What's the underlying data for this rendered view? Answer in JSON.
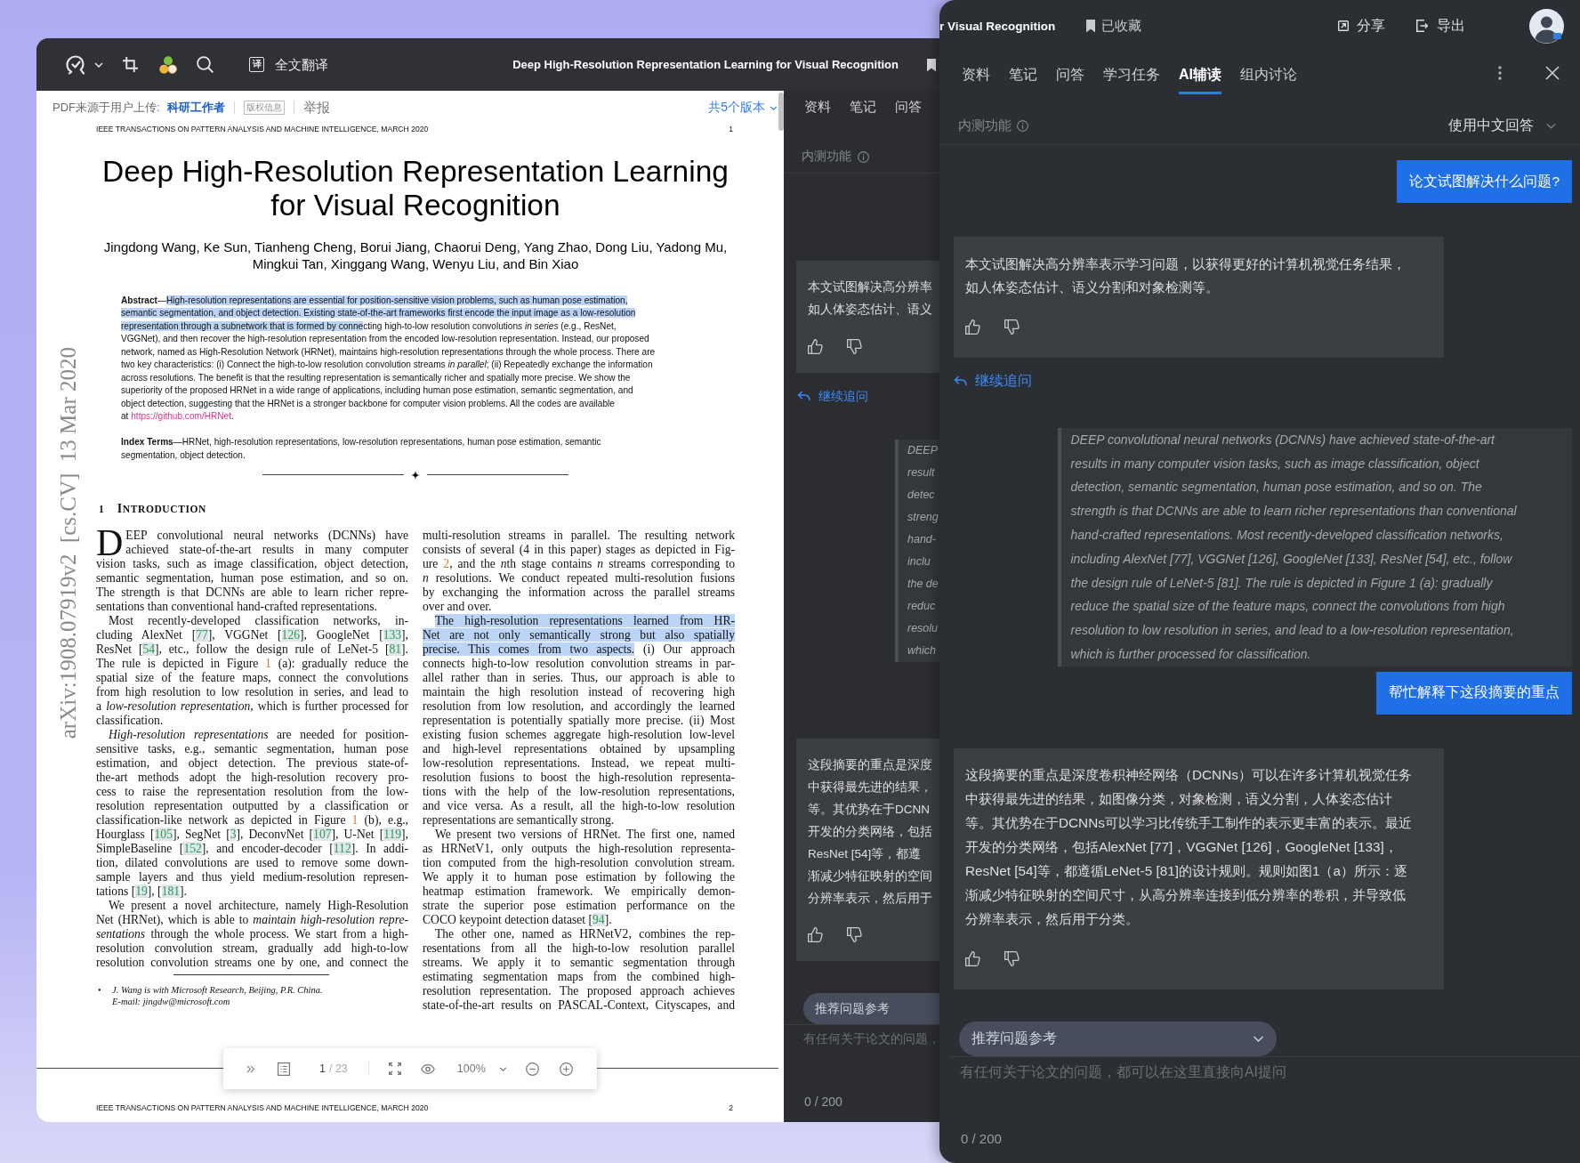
{
  "pdf_window": {
    "toolbar": {
      "translate_glyph": "译",
      "translate_label": "全文翻译",
      "title": "Deep High-Resolution Representation Learning for Visual Recognition",
      "saved": true
    },
    "source_bar": {
      "prefix": "PDF来源于用户上传:",
      "uploader": "科研工作者",
      "copyright_tag": "版权信息",
      "report": "举报",
      "versions": "共5个版本"
    },
    "paper": {
      "running_head": "IEEE TRANSACTIONS ON PATTERN ANALYSIS AND MACHINE INTELLIGENCE, MARCH 2020",
      "page_number": "1",
      "side_stamp": "arXiv:1908.07919v2  [cs.CV]  13 Mar 2020",
      "title_lines": [
        "Deep High-Resolution Representation Learning",
        "for Visual Recognition"
      ],
      "author_lines": [
        "Jingdong Wang, Ke Sun, Tianheng Cheng, Borui Jiang, Chaorui Deng, Yang Zhao, Dong Liu, Yadong Mu,",
        "Mingkui Tan, Xinggang Wang, Wenyu Liu, and Bin Xiao"
      ],
      "abstract": [
        [
          "**Abstract**—",
          {
            "kind": "highlight",
            "text": "High-resolution representations are essential for position-sensitive vision problems, such as human pose estimation,"
          }
        ],
        [
          {
            "kind": "highlight",
            "text": "semantic segmentation, and object detection. Existing state-of-the-art frameworks first encode the input image as a low-resolution"
          }
        ],
        [
          {
            "kind": "highlight",
            "text": "representation through a subnetwork that is formed by conne"
          },
          "cting high-to-low resolution convolutions *in series* (e.g., ResNet,"
        ],
        "VGGNet), and then recover the high-resolution representation from the encoded low-resolution representation. Instead, our proposed",
        "network, named as High-Resolution Network (HRNet), maintains high-resolution representations through the whole process. There are",
        "two key characteristics: (i) Connect the high-to-low resolution convolution streams *in parallel*; (ii) Repeatedly exchange the information",
        "across resolutions. The benefit is that the resulting representation is semantically richer and spatially more precise. We show the",
        "superiority of the proposed HRNet in a wide range of applications, including human pose estimation, semantic segmentation, and",
        "object detection, suggesting that the HRNet is a stronger backbone for computer vision problems. All the codes are available",
        [
          "at ",
          {
            "kind": "link",
            "text": "https://github.com/HRNet"
          },
          "."
        ]
      ],
      "index_terms": [
        "**Index Terms**—HRNet, high-resolution representations, low-resolution representations, human pose estimation, semantic",
        "segmentation, object detection."
      ],
      "section": {
        "number": "1",
        "title": "INTRODUCTION"
      },
      "columns": [
        [
          {
            "kind": "dropcap",
            "drop_cap": "D",
            "continues_next": false,
            "lines": [
              "EEP convolutional neural networks (DCNNs) have",
              "achieved state-of-the-art results in many computer",
              "vision tasks, such as image classification, object detection,",
              "semantic segmentation, human pose estimation, and so on.",
              "The strength is that DCNNs are able to learn richer repre-",
              "sentations than conventional hand-crafted representations."
            ]
          },
          {
            "kind": "indented",
            "lines": [
              "Most recently-developed classification networks, in-",
              [
                "cluding AlexNet [",
                {
                  "kind": "cite",
                  "text": "77"
                },
                "], VGGNet [",
                {
                  "kind": "cite",
                  "text": "126"
                },
                "], GoogleNet [",
                {
                  "kind": "cite",
                  "text": "133"
                },
                "],"
              ],
              [
                "ResNet [",
                {
                  "kind": "cite",
                  "text": "54"
                },
                "], etc., follow the design rule of LeNet-5 [",
                {
                  "kind": "cite",
                  "text": "81"
                },
                "]."
              ],
              [
                "The rule is depicted in Figure ",
                {
                  "kind": "figref",
                  "text": "1"
                },
                " (a): gradually reduce the"
              ],
              "spatial size of the feature maps, connect the convolutions",
              "from high resolution to low resolution in series, and lead to",
              "a *low-resolution representation*, which is further processed for",
              "classification."
            ]
          },
          {
            "kind": "indented",
            "continues_next": false,
            "lines": [
              "*High-resolution representations* are needed for position-",
              "sensitive tasks, e.g., semantic segmentation, human pose",
              "estimation, and object detection. The previous state-of-",
              "the-art methods adopt the high-resolution recovery pro-",
              "cess to raise the representation resolution from the low-",
              "resolution representation outputted by a classification or",
              [
                "classification-like network as depicted in Figure ",
                {
                  "kind": "figref",
                  "text": "1"
                },
                " (b), e.g.,"
              ],
              [
                "Hourglass [",
                {
                  "kind": "cite",
                  "text": "105"
                },
                "], SegNet [",
                {
                  "kind": "cite",
                  "text": "3"
                },
                "], DeconvNet [",
                {
                  "kind": "cite",
                  "text": "107"
                },
                "], U-Net [",
                {
                  "kind": "cite",
                  "text": "119"
                },
                "],"
              ],
              [
                "SimpleBaseline [",
                {
                  "kind": "cite",
                  "text": "152"
                },
                "], and encoder-decoder [",
                {
                  "kind": "cite",
                  "text": "112"
                },
                "]. In addi-"
              ],
              "tion, dilated convolutions are used to remove some down-",
              "sample layers and thus yield medium-resolution represen-",
              [
                "tations [",
                {
                  "kind": "cite",
                  "text": "19"
                },
                "], [",
                {
                  "kind": "cite",
                  "text": "181"
                },
                "]."
              ]
            ]
          },
          {
            "kind": "indented",
            "continues_next": true,
            "lines": [
              "We present a novel architecture, namely High-Resolution",
              "Net (HRNet), which is able to *maintain high-resolution repre-*",
              "*sentations* through the whole process. We start from a high-",
              "resolution convolution stream, gradually add high-to-low",
              "resolution convolution streams one by one, and connect the"
            ]
          }
        ],
        [
          {
            "kind": "continued",
            "continues_next": false,
            "lines": [
              "multi-resolution streams in parallel. The resulting network",
              "consists of several (4 in this paper) stages as depicted in Fig-",
              [
                "ure ",
                {
                  "kind": "figref",
                  "text": "2"
                },
                ", and the *n*",
                "th stage contains *n* streams corresponding to"
              ],
              "*n* resolutions. We conduct repeated multi-resolution fusions",
              "by exchanging the information across the parallel streams",
              "over and over."
            ]
          },
          {
            "kind": "indented",
            "continues_next": false,
            "lines": [
              [
                {
                  "kind": "highlight",
                  "text": "The high-resolution representations learned from HR-"
                }
              ],
              [
                {
                  "kind": "highlight",
                  "text": "Net are not only semantically strong but also spatially"
                }
              ],
              [
                {
                  "kind": "highlight",
                  "text": "precise. This comes from two aspects."
                },
                " (i) Our approach"
              ],
              "connects high-to-low resolution convolution streams in par-",
              "allel rather than in series. Thus, our approach is able to",
              "maintain the high resolution instead of recovering high",
              "resolution from low resolution, and accordingly the learned",
              "representation is potentially spatially more precise. (ii) Most",
              "existing fusion schemes aggregate high-resolution low-level",
              "and high-level representations obtained by upsampling",
              "low-resolution representations. Instead, we repeat multi-",
              "resolution fusions to boost the high-resolution representa-",
              "tions with the help of the low-resolution representations,",
              "and vice versa. As a result, all the high-to-low resolution",
              "representations are semantically strong."
            ]
          },
          {
            "kind": "indented",
            "continues_next": false,
            "lines": [
              "We present two versions of HRNet. The first one, named",
              "as HRNetV1, only outputs the high-resolution representa-",
              "tion computed from the high-resolution convolution stream.",
              "We apply it to human pose estimation by following the",
              "heatmap estimation framework. We empirically demon-",
              "strate the superior pose estimation performance on the",
              [
                "COCO keypoint detection dataset [",
                {
                  "kind": "cite",
                  "text": "94"
                },
                "]."
              ]
            ]
          },
          {
            "kind": "indented",
            "continues_next": true,
            "lines": [
              "The other one, named as HRNetV2, combines the rep-",
              "resentations from all the high-to-low resolution parallel",
              "streams. We apply it to semantic segmentation through",
              "estimating segmentation maps from the combined high-",
              "resolution representation. The proposed approach achieves",
              "state-of-the-art results on PASCAL-Context, Cityscapes, and"
            ]
          }
        ]
      ],
      "footnote": {
        "marker": "•",
        "lines": [
          "J. Wang is with Microsoft Research, Beijing, P.R. China.",
          "E-mail: jingdw@microsoft.com"
        ]
      }
    },
    "next_page": {
      "running_head": "IEEE TRANSACTIONS ON PATTERN ANALYSIS AND MACHINE INTELLIGENCE, MARCH 2020",
      "page_number": "2"
    },
    "viewer_bar": {
      "page": "1",
      "total": "/ 23",
      "zoom": "100%"
    },
    "side_panel": {
      "tabs": [
        {
          "label": "资料",
          "selected": false
        },
        {
          "label": "笔记",
          "selected": false
        },
        {
          "label": "问答",
          "selected": false
        }
      ],
      "beta_label": "内测功能",
      "messages": [
        {
          "kind": "answer",
          "lines": [
            "本文试图解决高分辨率",
            "如人体姿态估计、语义"
          ]
        },
        {
          "kind": "follow_up",
          "label": "继续追问"
        },
        {
          "kind": "quote",
          "lines": [
            "DEEP",
            "result",
            "detec",
            "streng",
            "hand-",
            "inclu",
            "the de",
            "reduc",
            "resolu",
            "which"
          ]
        },
        {
          "kind": "answer",
          "lines": [
            "这段摘要的重点是深度",
            "中获得最先进的结果，",
            "等。其优势在于DCNN",
            "开发的分类网络，包括",
            "ResNet [54]等，都遵",
            "渐减少特征映射的空间",
            "分辨率表示，然后用于"
          ]
        }
      ],
      "suggest": "推荐问题参考",
      "placeholder": "有任何关于论文的问题，",
      "counter": "0 / 200"
    }
  },
  "ai_panel": {
    "title": "r Visual Recognition",
    "bookmark": {
      "label": "已收藏",
      "saved": true
    },
    "actions": [
      {
        "kind": "share",
        "label": "分享"
      },
      {
        "kind": "export",
        "label": "导出"
      }
    ],
    "tabs": [
      {
        "label": "资料",
        "selected": false
      },
      {
        "label": "笔记",
        "selected": false
      },
      {
        "label": "问答",
        "selected": false
      },
      {
        "label": "学习任务",
        "selected": false
      },
      {
        "label": "AI辅读",
        "selected": true
      },
      {
        "label": "组内讨论",
        "selected": false
      }
    ],
    "beta_label": "内测功能",
    "language": "使用中文回答",
    "messages": [
      {
        "kind": "question",
        "text": "论文试图解决什么问题?"
      },
      {
        "kind": "answer",
        "lines": [
          "本文试图解决高分辨率表示学习问题，以获得更好的计算机视觉任务结果，",
          "如人体姿态估计、语义分割和对象检测等。"
        ]
      },
      {
        "kind": "follow_up",
        "label": "继续追问"
      },
      {
        "kind": "quote",
        "lines": [
          "DEEP convolutional neural networks (DCNNs) have achieved state-of-the-art",
          "results in many computer vision tasks, such as image classification, object",
          "detection, semantic segmentation, human pose estimation, and so on. The",
          "strength is that DCNNs are able to learn richer representations than conventional",
          "hand-crafted representations. Most recently-developed classification networks,",
          "including AlexNet [77], VGGNet [126], GoogleNet [133], ResNet [54], etc., follow",
          "the design rule of LeNet-5 [81]. The rule is depicted in Figure 1 (a): gradually",
          "reduce the spatial size of the feature maps, connect the convolutions from high",
          "resolution to low resolution in series, and lead to a low-resolution representation,",
          "which is further processed for classification."
        ]
      },
      {
        "kind": "question",
        "text": "帮忙解释下这段摘要的重点"
      },
      {
        "kind": "answer",
        "lines": [
          "这段摘要的重点是深度卷积神经网络（DCNNs）可以在许多计算机视觉任务",
          "中获得最先进的结果，如图像分类，对象检测，语义分割，人体姿态估计",
          "等。其优势在于DCNNs可以学习比传统手工制作的表示更丰富的表示。最近",
          "开发的分类网络，包括AlexNet [77]，VGGNet [126]，GoogleNet [133]，",
          "ResNet [54]等，都遵循LeNet-5 [81]的设计规则。规则如图1（a）所示：逐",
          "渐减少特征映射的空间尺寸，从高分辨率连接到低分辨率的卷积，并导致低",
          "分辨率表示，然后用于分类。"
        ]
      }
    ],
    "suggest": "推荐问题参考",
    "placeholder": "有任何关于论文的问题，都可以在这里直接向AI提问",
    "counter": "0 / 200"
  }
}
